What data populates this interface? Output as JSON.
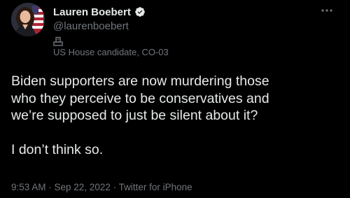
{
  "author": {
    "display_name": "Lauren Boebert",
    "handle": "@laurenboebert",
    "verified": true,
    "avatar_icon": "profile-photo-with-flag",
    "label_icon": "ballot-box-icon",
    "label": "US House candidate, CO-03"
  },
  "tweet": {
    "lines": [
      "Biden supporters are now murdering those",
      "who they perceive to be conservatives and",
      "we’re supposed to just be silent about it?",
      "I don’t think so."
    ]
  },
  "meta": {
    "time": "9:53 AM",
    "separator": " · ",
    "date": "Sep 22, 2022",
    "source": "Twitter for iPhone"
  },
  "colors": {
    "background": "#000000",
    "text_primary": "#e7e9ea",
    "text_secondary": "#71767b",
    "verified_blue": "#1d9bf0"
  }
}
